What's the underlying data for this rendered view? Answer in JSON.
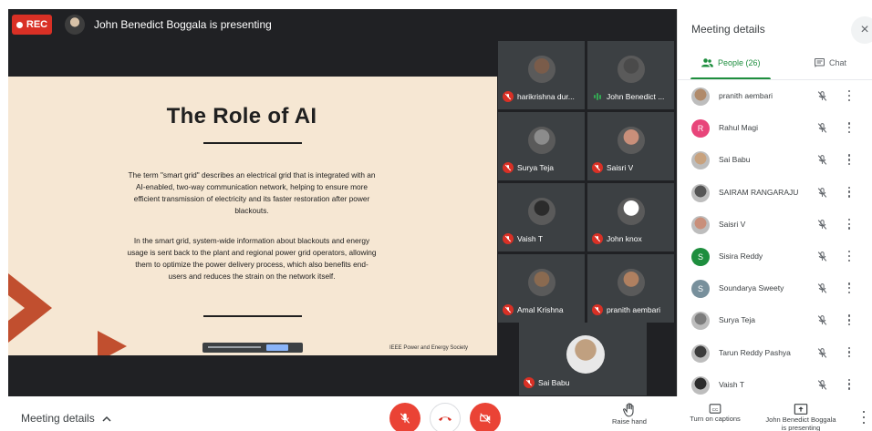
{
  "topbar": {
    "rec_label": "REC",
    "presenting_text": "John Benedict Boggala is presenting"
  },
  "slide": {
    "title": "The Role of AI",
    "para1": "The term \"smart grid\" describes an electrical grid that is integrated with an AI-enabled, two-way communication network, helping to ensure more efficient transmission of electricity and its faster restoration after power blackouts.",
    "para2": "In the smart grid, system-wide information about blackouts and energy usage is sent back to the plant and regional power grid operators, allowing them to optimize the power delivery process, which also benefits end-users and reduces the strain on the network itself.",
    "footer": "IEEE Power and Energy Society"
  },
  "tiles": [
    {
      "name": "harikrishna dur...",
      "mic": "muted",
      "avatar_color": "#7a5c4a"
    },
    {
      "name": "John Benedict ...",
      "mic": "speaking",
      "avatar_color": "#4a4a4a"
    },
    {
      "name": "Surya Teja",
      "mic": "muted",
      "avatar_color": "#8c8c8c"
    },
    {
      "name": "Saisri V",
      "mic": "muted",
      "avatar_color": "#c98f7a"
    },
    {
      "name": "Vaish T",
      "mic": "muted",
      "avatar_color": "#2b2b2b"
    },
    {
      "name": "John knox",
      "mic": "muted",
      "avatar_color": "#ffffff"
    },
    {
      "name": "Amal Krishna",
      "mic": "muted",
      "avatar_color": "#8a6a50"
    },
    {
      "name": "pranith aembari",
      "mic": "muted",
      "avatar_color": "#b08060"
    }
  ],
  "featured_tile": {
    "name": "Sai Babu",
    "mic": "muted",
    "avatar_color": "#c0a080"
  },
  "panel": {
    "title": "Meeting details",
    "close_icon": "×",
    "tab_people": "People (26)",
    "tab_chat": "Chat",
    "people": [
      {
        "name": "pranith aembari",
        "initial": "",
        "color": "#b08a6a"
      },
      {
        "name": "Rahul Magi",
        "initial": "R",
        "color": "#e8457a"
      },
      {
        "name": "Sai Babu",
        "initial": "",
        "color": "#c8a27e"
      },
      {
        "name": "SAIRAM RANGARAJU",
        "initial": "",
        "color": "#555555"
      },
      {
        "name": "Saisri V",
        "initial": "",
        "color": "#c98f7a"
      },
      {
        "name": "Sisira Reddy",
        "initial": "S",
        "color": "#1e8e3e"
      },
      {
        "name": "Soundarya Sweety",
        "initial": "S",
        "color": "#78909c"
      },
      {
        "name": "Surya Teja",
        "initial": "",
        "color": "#7d7d7d"
      },
      {
        "name": "Tarun Reddy Pashya",
        "initial": "",
        "color": "#3c3c3c"
      },
      {
        "name": "Vaish T",
        "initial": "",
        "color": "#2b2b2b"
      }
    ]
  },
  "bottom": {
    "meeting_details": "Meeting details",
    "raise_hand": "Raise hand",
    "captions": "Turn on captions",
    "presenting_line1": "John Benedict Boggala",
    "presenting_line2": "is presenting"
  },
  "colors": {
    "danger": "#ea4335",
    "green": "#1e8e3e",
    "stage": "#202124"
  }
}
